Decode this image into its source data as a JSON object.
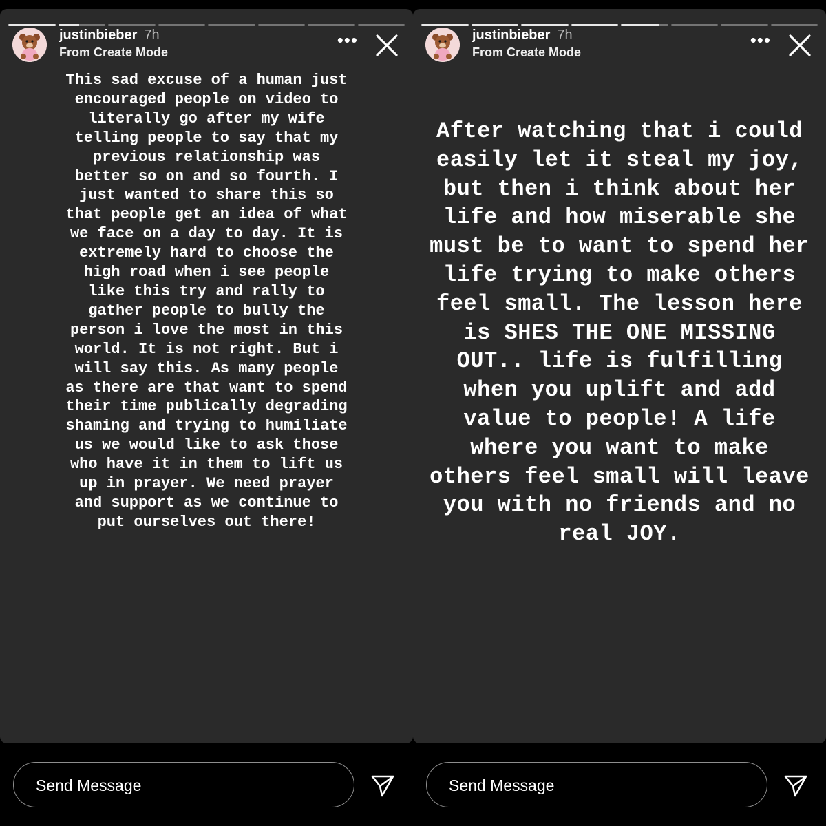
{
  "stories": [
    {
      "user": {
        "username": "justinbieber",
        "time": "7h",
        "subtitle": "From Create Mode"
      },
      "progress": [
        1,
        0.45,
        0,
        0,
        0,
        0,
        0,
        0
      ],
      "more_icon": "more-horizontal-icon",
      "close_icon": "close-icon",
      "text": "This sad excuse of a human just encouraged people on video to literally go after my wife telling people to say that my previous relationship was better so on and so fourth. I just wanted to share this so that people get an idea of what we face on a day to day. It is extremely hard to choose the high road when i see people like this try and rally to gather people to bully the person i love the most in this world. It is not right. But i will say this. As many people as there are that want to spend their time publically degrading shaming and trying to humiliate us we would like to ask those who have it in them to lift us up in prayer. We need prayer and support as we continue to put ourselves out there!",
      "message_placeholder": "Send Message",
      "send_icon": "send-icon"
    },
    {
      "user": {
        "username": "justinbieber",
        "time": "7h",
        "subtitle": "From Create Mode"
      },
      "progress": [
        1,
        1,
        1,
        1,
        0.8,
        0,
        0,
        0
      ],
      "more_icon": "more-horizontal-icon",
      "close_icon": "close-icon",
      "text": "After watching that i could easily let it steal my joy, but then i think about her life and how miserable she must be to want to spend her life trying to make others feel small. The lesson here is SHES THE ONE MISSING OUT.. life is fulfilling when you uplift and add value to people! A life where you want to make others feel small will leave you with no friends and no real JOY.",
      "message_placeholder": "Send Message",
      "send_icon": "send-icon"
    }
  ]
}
